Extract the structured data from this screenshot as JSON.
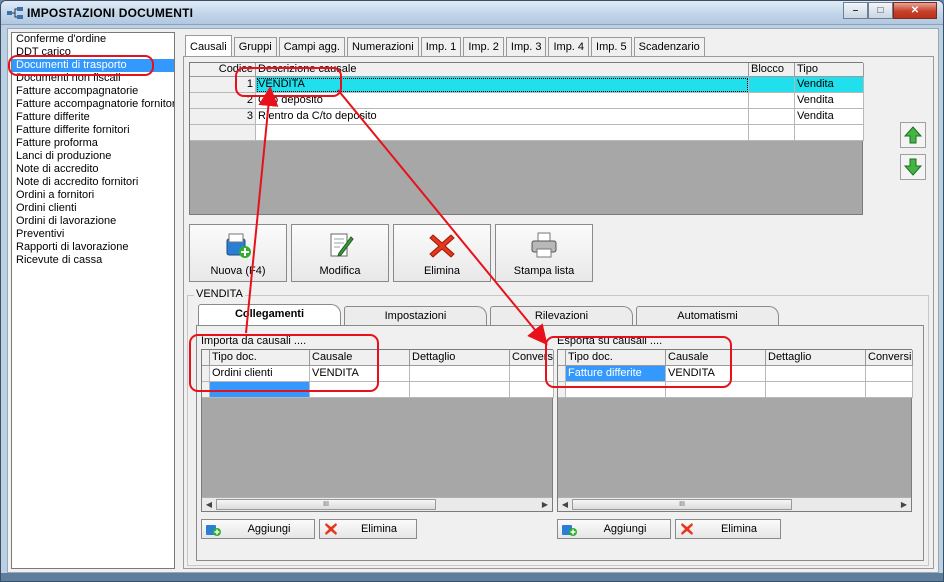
{
  "window": {
    "title": "IMPOSTAZIONI DOCUMENTI",
    "controls": {
      "minimize": "–",
      "maximize": "□",
      "close": "✕"
    }
  },
  "sidebar": {
    "items": [
      {
        "label": "Conferme d'ordine",
        "selected": false
      },
      {
        "label": "DDT carico",
        "selected": false
      },
      {
        "label": "Documenti di trasporto",
        "selected": true
      },
      {
        "label": "Documenti non fiscali",
        "selected": false
      },
      {
        "label": "Fatture accompagnatorie",
        "selected": false
      },
      {
        "label": "Fatture accompagnatorie fornitori",
        "selected": false
      },
      {
        "label": "Fatture differite",
        "selected": false
      },
      {
        "label": "Fatture differite fornitori",
        "selected": false
      },
      {
        "label": "Fatture proforma",
        "selected": false
      },
      {
        "label": "Lanci di produzione",
        "selected": false
      },
      {
        "label": "Note di accredito",
        "selected": false
      },
      {
        "label": "Note di accredito fornitori",
        "selected": false
      },
      {
        "label": "Ordini a fornitori",
        "selected": false
      },
      {
        "label": "Ordini clienti",
        "selected": false
      },
      {
        "label": "Ordini di lavorazione",
        "selected": false
      },
      {
        "label": "Preventivi",
        "selected": false
      },
      {
        "label": "Rapporti di lavorazione",
        "selected": false
      },
      {
        "label": "Ricevute di cassa",
        "selected": false
      }
    ]
  },
  "tabs": [
    "Causali",
    "Gruppi",
    "Campi agg.",
    "Numerazioni",
    "Imp. 1",
    "Imp. 2",
    "Imp. 3",
    "Imp. 4",
    "Imp. 5",
    "Scadenzario"
  ],
  "active_tab": "Causali",
  "causali_grid": {
    "columns": [
      "Codice",
      "Descrizione causale",
      "Blocco",
      "Tipo"
    ],
    "rows": [
      {
        "codice": "1",
        "descrizione": "VENDITA",
        "blocco": "",
        "tipo": "Vendita"
      },
      {
        "codice": "2",
        "descrizione": "C/to deposito",
        "blocco": "",
        "tipo": "Vendita"
      },
      {
        "codice": "3",
        "descrizione": "Rientro da C/to deposito",
        "blocco": "",
        "tipo": "Vendita"
      }
    ]
  },
  "move_buttons": {
    "up_icon": "arrow-up-icon",
    "down_icon": "arrow-down-icon"
  },
  "toolbar": {
    "nuova": "Nuova (F4)",
    "modifica": "Modifica",
    "elimina": "Elimina",
    "stampa": "Stampa lista"
  },
  "group": {
    "legend": "VENDITA",
    "subtabs": [
      "Collegamenti",
      "Impostazioni",
      "Rilevazioni",
      "Automatismi"
    ],
    "active_subtab": "Collegamenti"
  },
  "importa": {
    "label": "Importa da causali ....",
    "columns": [
      "Tipo doc.",
      "Causale",
      "Dettaglio",
      "Conversi"
    ],
    "rows": [
      {
        "tipo": "Ordini clienti",
        "causale": "VENDITA"
      }
    ],
    "aggiungi": "Aggiungi",
    "elimina": "Elimina"
  },
  "esporta": {
    "label": "Esporta su causali ....",
    "columns": [
      "Tipo doc.",
      "Causale",
      "Dettaglio",
      "Conversi"
    ],
    "rows": [
      {
        "tipo": "Fatture differite",
        "causale": "VENDITA"
      }
    ],
    "aggiungi": "Aggiungi",
    "elimina": "Elimina"
  },
  "scroll_thumb": "III",
  "colors": {
    "selection": "#3399ff",
    "highlight_row": "#1fe0ec",
    "annotation": "#e8101a"
  }
}
